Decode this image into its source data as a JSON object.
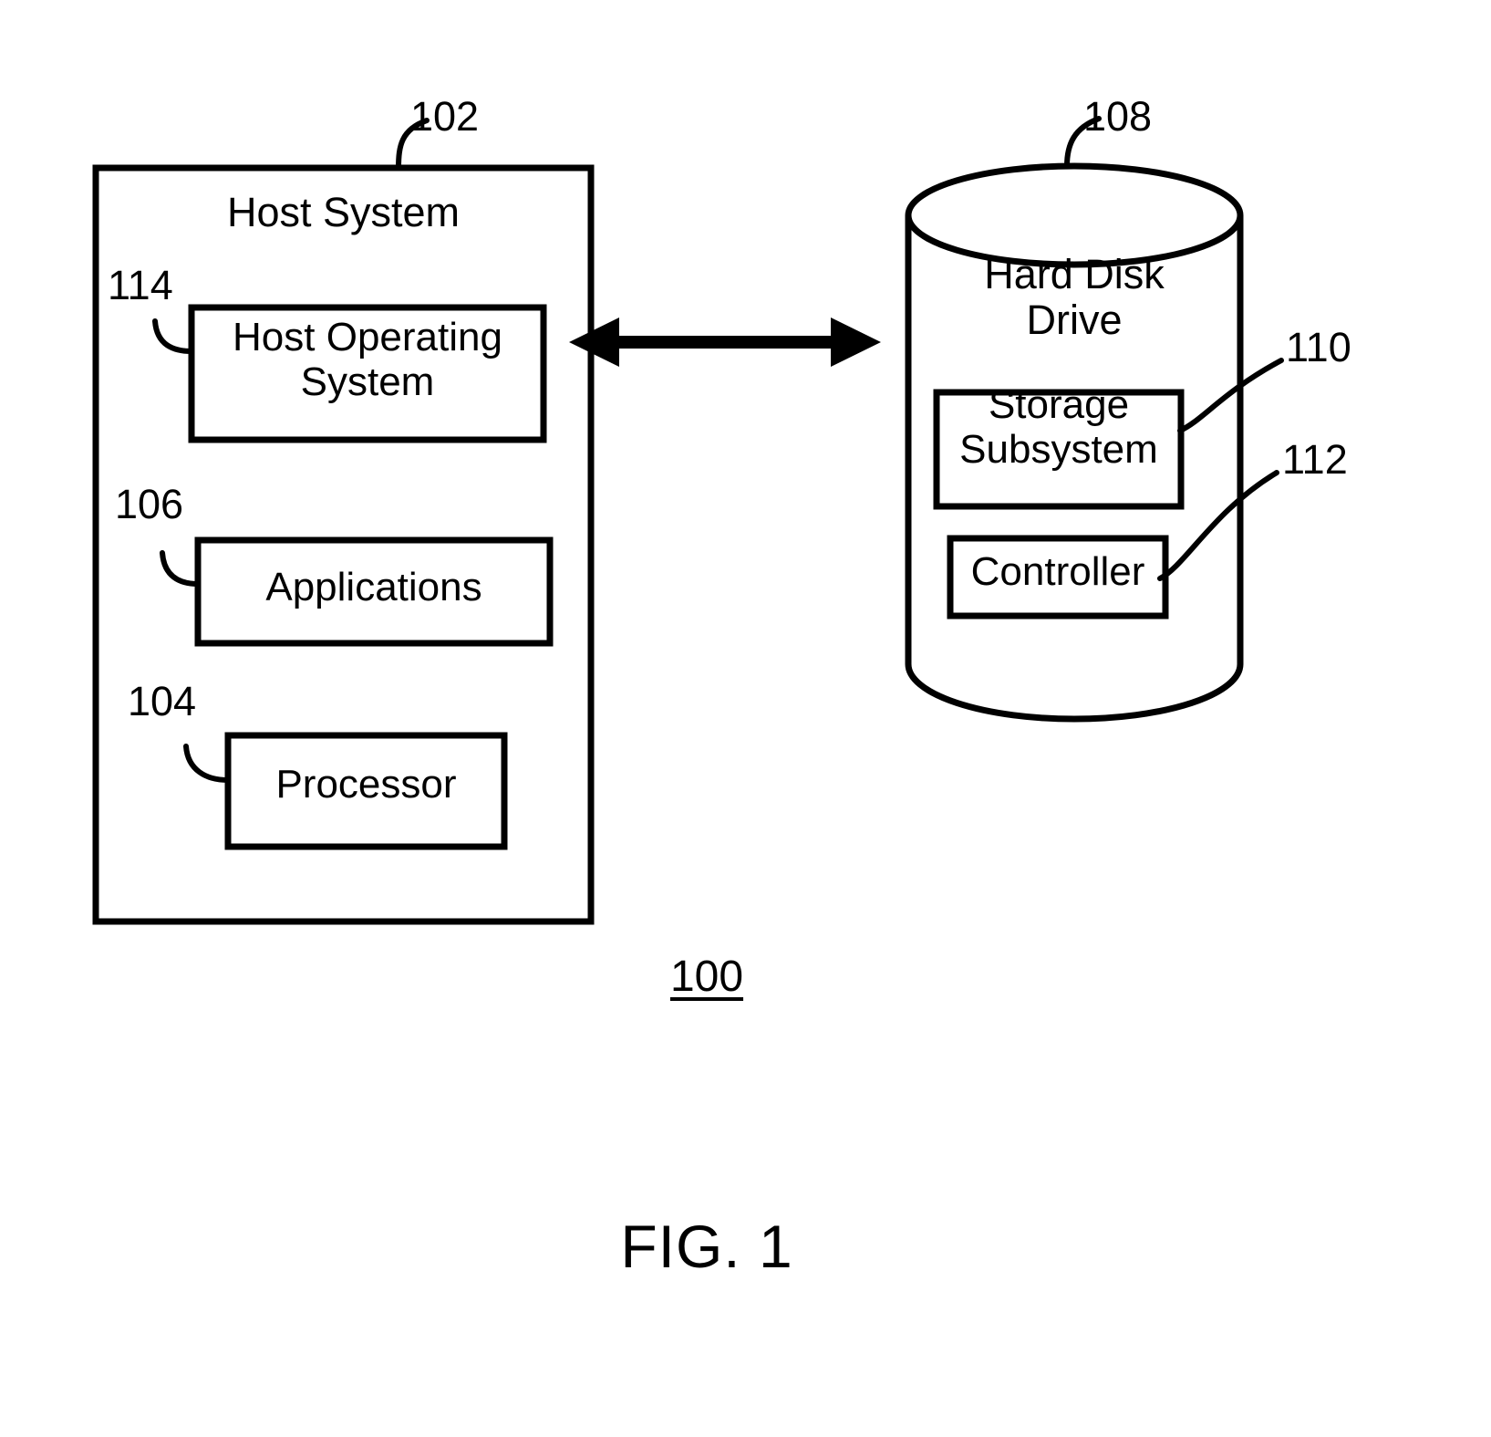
{
  "figure": {
    "caption": "FIG. 1",
    "system_number": "100"
  },
  "host_system": {
    "title": "Host System",
    "ref": "102",
    "components": [
      {
        "label": "Host Operating\nSystem",
        "ref": "114"
      },
      {
        "label": "Applications",
        "ref": "106"
      },
      {
        "label": "Processor",
        "ref": "104"
      }
    ]
  },
  "hard_disk_drive": {
    "title": "Hard Disk\nDrive",
    "ref": "108",
    "components": [
      {
        "label": "Storage\nSubsystem",
        "ref": "110"
      },
      {
        "label": "Controller",
        "ref": "112"
      }
    ]
  },
  "connection": {
    "name": "bidirectional-link"
  },
  "colors": {
    "stroke": "#000000",
    "background": "#ffffff"
  }
}
